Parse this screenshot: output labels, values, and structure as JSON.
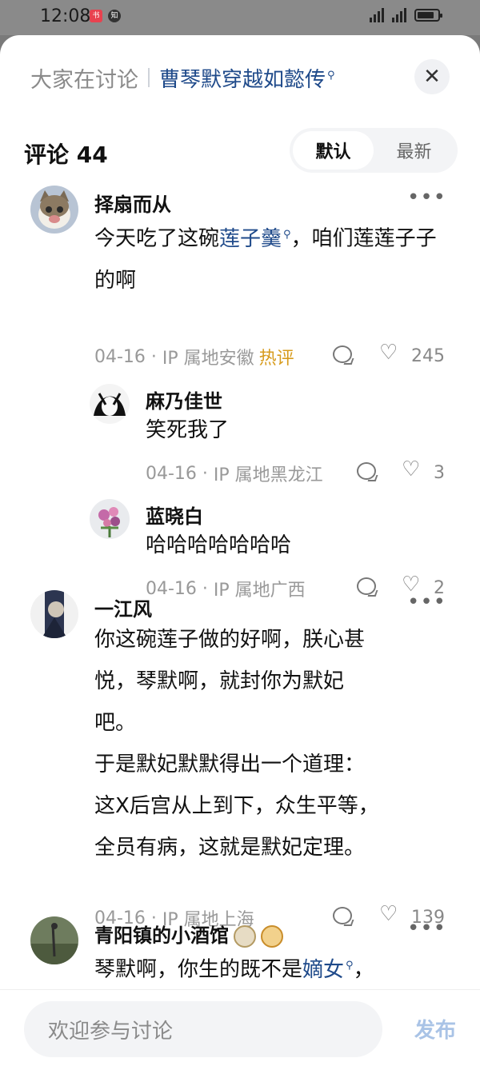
{
  "status_bar": {
    "time": "12:08",
    "app_icon_1": "书",
    "app_icon_2": "知"
  },
  "header": {
    "label": "大家在讨论",
    "topic": "曹琴默穿越如懿传",
    "close_icon": "close-icon"
  },
  "comments_header": {
    "title": "评论 44",
    "tabs": [
      "默认",
      "最新"
    ],
    "active_tab": "默认"
  },
  "comments": [
    {
      "name": "择扇而从",
      "text_before": "今天吃了这碗",
      "text_link": "莲子羹",
      "text_after": "，咱们莲莲子子的啊",
      "date": "04-16",
      "ip": "IP 属地安徽",
      "hot": "热评",
      "likes": "245",
      "replies": [
        {
          "name": "麻乃佳世",
          "text": "笑死我了",
          "date": "04-16",
          "ip": "IP 属地黑龙江",
          "likes": "3"
        },
        {
          "name": "蓝晓白",
          "text": "哈哈哈哈哈哈哈",
          "date": "04-16",
          "ip": "IP 属地广西",
          "likes": "2"
        }
      ]
    },
    {
      "name": "一江风",
      "text_lines": [
        "你这碗莲子做的好啊，朕心甚",
        "悦，琴默啊，就封你为默妃",
        "吧。",
        "于是默妃默默得出一个道理：",
        "这X后宫从上到下，众生平等，",
        "全员有病，这就是默妃定理。"
      ],
      "date": "04-16",
      "ip": "IP 属地上海",
      "likes": "139"
    },
    {
      "name": "青阳镇的小酒馆",
      "text_before": "琴默啊，你生的既不是",
      "text_link": "嫡女",
      "text_after": "，"
    }
  ],
  "bottom": {
    "placeholder": "欢迎参与讨论",
    "publish": "发布"
  },
  "colors": {
    "link": "#1f4a8a",
    "hot": "#d79b1c",
    "publish": "#a9c3e6"
  }
}
